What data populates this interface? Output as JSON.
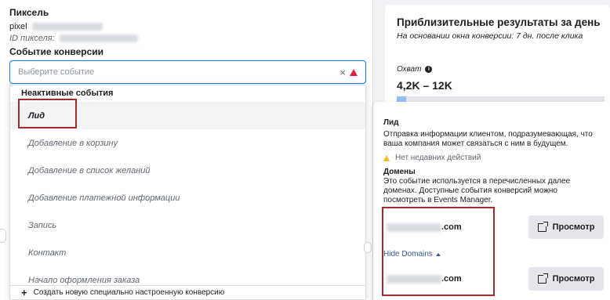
{
  "pixel_section": {
    "title": "Пиксель",
    "pixel_label": "pixel",
    "pixel_id_label": "ID пикселя:"
  },
  "conversion": {
    "title": "Событие конверсии",
    "placeholder": "Выберите событие",
    "clear_icon": "×"
  },
  "dropdown": {
    "header": "Неактивные события",
    "items": [
      {
        "label": "Лид"
      },
      {
        "label": "Добавление в корзину"
      },
      {
        "label": "Добавление в список желаний"
      },
      {
        "label": "Добавление платежной информации"
      },
      {
        "label": "Запись"
      },
      {
        "label": "Контакт"
      },
      {
        "label": "Начало оформления заказа"
      }
    ],
    "footer": "Создать новую специально настроенную конверсию",
    "footer_icon": "+"
  },
  "results": {
    "title": "Приблизительные результаты за день",
    "subtitle": "На основании окна конверсии: 7 дн. после клика",
    "reach_label": "Охват",
    "reach_range": "4,2K – 12K",
    "reach_fill_fraction": 0.045
  },
  "tooltip": {
    "title": "Лид",
    "description": "Отправка информации клиентом, подразумевающая, что ваша компания может связаться с ним в будущем.",
    "warning": "Нет недавних действий",
    "domains_title": "Домены",
    "domains_description": "Это событие используется в перечисленных далее доменах. Доступные события конверсий можно посмотреть в Events Manager.",
    "domains": [
      {
        "suffix": ".com",
        "button": "Просмотр"
      },
      {
        "suffix": ".com",
        "button": "Просмотр"
      }
    ],
    "hide_domains": "Hide Domains"
  },
  "colors": {
    "accent": "#1877f2",
    "highlight_box": "#a52a2a",
    "error": "#e41e3f",
    "warning": "#f7b928",
    "link": "#385898"
  }
}
